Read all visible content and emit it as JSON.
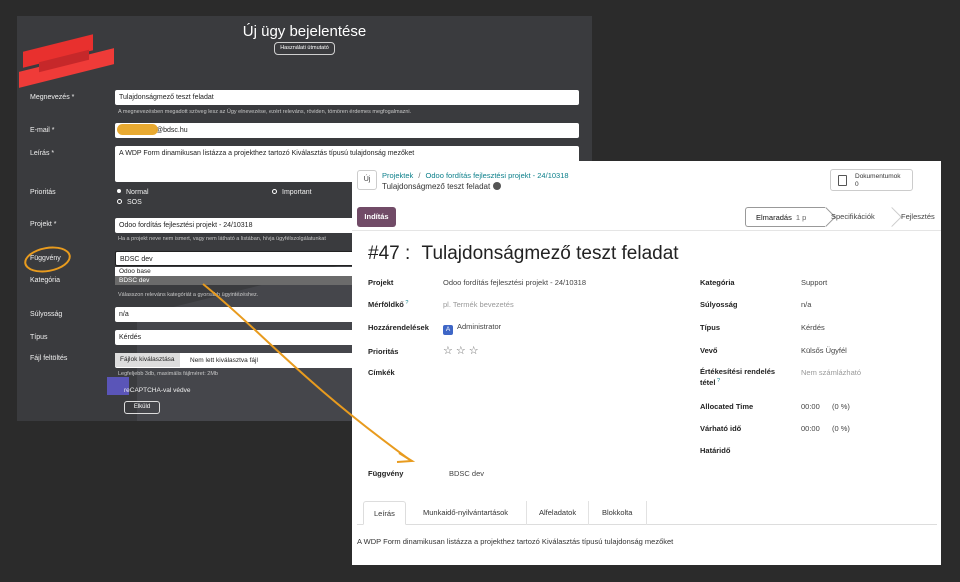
{
  "form": {
    "title": "Új ügy bejelentése",
    "guide_button": "Használati útmutató",
    "fields": {
      "name_label": "Megnevezés *",
      "name_value": "Tulajdonságmező teszt feladat",
      "name_help": "A megnevezésben megadott szöveg lesz az Ügy elnevezése, ezért releváns, röviden, tömören érdemes megfogalmazni.",
      "email_label": "E-mail *",
      "email_value": "@bdsc.hu",
      "desc_label": "Leírás *",
      "desc_value": "A WDP Form dinamikusan listázza a projekthez tartozó Kiválasztás típusú tulajdonság mezőket",
      "priority_label": "Prioritás",
      "priority_options": [
        "Normal",
        "Important",
        "SOS"
      ],
      "project_label": "Projekt *",
      "project_value": "Odoo fordítás fejlesztési projekt - 24/10318",
      "project_help": "Ha a projekt neve nem ismert, vagy nem látható a listában, hívja ügyfélszolgálatunkat",
      "dependency_label": "Függvény",
      "dependency_value": "BDSC dev",
      "dependency_options": [
        "Odoo base",
        "BDSC dev"
      ],
      "category_label": "Kategória",
      "category_help": "Válasszon releváns kategóriát a gyorsabb ügyintézéshez.",
      "severity_label": "Súlyosság",
      "severity_value": "n/a",
      "type_label": "Típus",
      "type_value": "Kérdés",
      "file_label": "Fájl feltöltés",
      "file_button": "Fájlok kiválasztása",
      "file_status": "Nem lett kiválasztva fájl",
      "file_help": "Legfeljebb 3db, maximális fájlméret: 2Mb",
      "recaptcha": "reCAPTCHA-val védve",
      "send_button": "Elküld"
    }
  },
  "odoo": {
    "new_button": "Új",
    "breadcrumb_root": "Projektek",
    "breadcrumb_sep": "/",
    "breadcrumb_project": "Odoo fordítás fejlesztési projekt - 24/10318",
    "breadcrumb_current": "Tulajdonságmező teszt feladat",
    "documents_label": "Dokumentumok",
    "documents_count": "0",
    "start_button": "Indítás",
    "stages": {
      "active": "Elmaradás",
      "active_count": "1 p",
      "next": "Specifikációk",
      "third": "Fejlesztés"
    },
    "task_number": "#47 :",
    "task_title": "Tulajdonságmező teszt feladat",
    "left": {
      "project_label": "Projekt",
      "project_value": "Odoo fordítás fejlesztési projekt - 24/10318",
      "milestone_label": "Mérföldkő",
      "milestone_placeholder": "pl. Termék bevezetés",
      "assignees_label": "Hozzárendelések",
      "assignee_initial": "A",
      "assignee_name": "Administrator",
      "priority_label": "Prioritás",
      "stars": "☆☆☆",
      "tags_label": "Címkék",
      "dependency_label": "Függvény",
      "dependency_value": "BDSC dev"
    },
    "right": {
      "category_label": "Kategória",
      "category_value": "Support",
      "severity_label": "Súlyosság",
      "severity_value": "n/a",
      "type_label": "Típus",
      "type_value": "Kérdés",
      "customer_label": "Vevő",
      "customer_value": "Külsős Ügyfél",
      "sales_line_label_1": "Értékesítési rendelés",
      "sales_line_label_2": "tétel",
      "sales_line_value": "Nem számlázható",
      "allocated_label": "Allocated Time",
      "allocated_value": "00:00",
      "allocated_pct": "(0 %)",
      "expected_label": "Várható idő",
      "expected_value": "00:00",
      "expected_pct": "(0 %)",
      "deadline_label": "Határidő"
    },
    "tabs": [
      "Leírás",
      "Munkaidő-nyilvántartások",
      "Alfeladatok",
      "Blokkolta"
    ],
    "description": "A WDP Form dinamikusan listázza a projekthez tartozó Kiválasztás típusú tulajdonság mezőket"
  },
  "colors": {
    "annotation": "#e89b1e",
    "odoo_primary": "#714b67",
    "link": "#0b7f8a"
  }
}
